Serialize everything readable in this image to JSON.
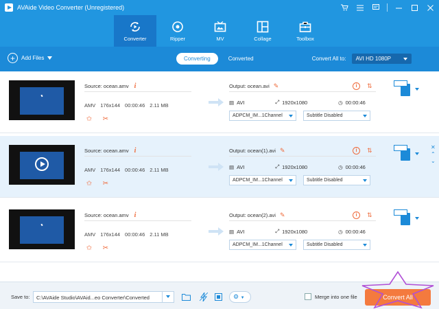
{
  "window": {
    "title": "AVAide Video Converter (Unregistered)",
    "controls": [
      "cart-icon",
      "menu-icon",
      "feedback-icon",
      "minimize-icon",
      "maximize-icon",
      "close-icon"
    ]
  },
  "nav": {
    "tabs": [
      {
        "label": "Converter",
        "icon": "converter-icon",
        "active": true
      },
      {
        "label": "Ripper",
        "icon": "ripper-icon",
        "active": false
      },
      {
        "label": "MV",
        "icon": "mv-icon",
        "active": false
      },
      {
        "label": "Collage",
        "icon": "collage-icon",
        "active": false
      },
      {
        "label": "Toolbox",
        "icon": "toolbox-icon",
        "active": false
      }
    ]
  },
  "toolbar": {
    "add_files": "Add Files",
    "seg_converting": "Converting",
    "seg_converted": "Converted",
    "convert_all_to_label": "Convert All to:",
    "convert_all_to_value": "AVI HD 1080P"
  },
  "files": [
    {
      "source": "Source: ocean.amv",
      "format": "AMV",
      "resolution": "176x144",
      "duration": "00:00:46",
      "size": "2.11 MB",
      "output": "Output: ocean.avi",
      "out_format": "AVI",
      "out_resolution": "1920x1080",
      "out_duration": "00:00:46",
      "audio": "ADPCM_IM...1Channel",
      "subtitle": "Subtitle Disabled",
      "selected": false
    },
    {
      "source": "Source: ocean.amv",
      "format": "AMV",
      "resolution": "176x144",
      "duration": "00:00:46",
      "size": "2.11 MB",
      "output": "Output: ocean(1).avi",
      "out_format": "AVI",
      "out_resolution": "1920x1080",
      "out_duration": "00:00:46",
      "audio": "ADPCM_IM...1Channel",
      "subtitle": "Subtitle Disabled",
      "selected": true
    },
    {
      "source": "Source: ocean.amv",
      "format": "AMV",
      "resolution": "176x144",
      "duration": "00:00:46",
      "size": "2.11 MB",
      "output": "Output: ocean(2).avi",
      "out_format": "AVI",
      "out_resolution": "1920x1080",
      "out_duration": "00:00:46",
      "audio": "ADPCM_IM...1Channel",
      "subtitle": "Subtitle Disabled",
      "selected": false
    }
  ],
  "bottom": {
    "save_to_label": "Save to:",
    "save_path": "C:\\AVAide Studio\\AVAid...eo Converter\\Converted",
    "merge_label": "Merge into one file",
    "merge_checked": false,
    "convert_all_button": "Convert All"
  },
  "colors": {
    "topbar": "#2196e0",
    "toolbar": "#1c8ad8",
    "accent": "#ef6a3a",
    "convert_button": "#f47a3e",
    "selected_row": "#e6f2fc"
  }
}
